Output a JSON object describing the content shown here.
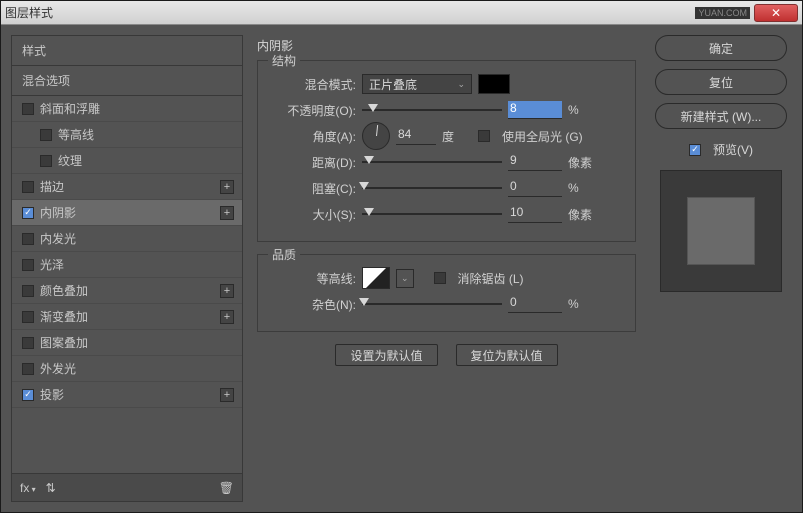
{
  "window": {
    "title": "图层样式"
  },
  "sidebar": {
    "styles_header": "样式",
    "blend_header": "混合选项",
    "items": [
      {
        "label": "斜面和浮雕",
        "checked": false,
        "sub": false,
        "plus": false
      },
      {
        "label": "等高线",
        "checked": false,
        "sub": true,
        "plus": false
      },
      {
        "label": "纹理",
        "checked": false,
        "sub": true,
        "plus": false
      },
      {
        "label": "描边",
        "checked": false,
        "sub": false,
        "plus": true
      },
      {
        "label": "内阴影",
        "checked": true,
        "sub": false,
        "plus": true,
        "selected": true
      },
      {
        "label": "内发光",
        "checked": false,
        "sub": false,
        "plus": false
      },
      {
        "label": "光泽",
        "checked": false,
        "sub": false,
        "plus": false
      },
      {
        "label": "颜色叠加",
        "checked": false,
        "sub": false,
        "plus": true
      },
      {
        "label": "渐变叠加",
        "checked": false,
        "sub": false,
        "plus": true
      },
      {
        "label": "图案叠加",
        "checked": false,
        "sub": false,
        "plus": false
      },
      {
        "label": "外发光",
        "checked": false,
        "sub": false,
        "plus": false
      },
      {
        "label": "投影",
        "checked": true,
        "sub": false,
        "plus": true
      }
    ],
    "fx_label": "fx"
  },
  "main": {
    "panel_title": "内阴影",
    "structure": {
      "title": "结构",
      "blend_mode_label": "混合模式:",
      "blend_mode_value": "正片叠底",
      "opacity_label": "不透明度(O):",
      "opacity_value": "8",
      "opacity_unit": "%",
      "angle_label": "角度(A):",
      "angle_value": "84",
      "angle_unit": "度",
      "global_light_label": "使用全局光 (G)",
      "distance_label": "距离(D):",
      "distance_value": "9",
      "distance_unit": "像素",
      "choke_label": "阻塞(C):",
      "choke_value": "0",
      "choke_unit": "%",
      "size_label": "大小(S):",
      "size_value": "10",
      "size_unit": "像素"
    },
    "quality": {
      "title": "品质",
      "contour_label": "等高线:",
      "antialias_label": "消除锯齿 (L)",
      "noise_label": "杂色(N):",
      "noise_value": "0",
      "noise_unit": "%"
    },
    "buttons": {
      "default": "设置为默认值",
      "reset": "复位为默认值"
    }
  },
  "right": {
    "ok": "确定",
    "cancel": "复位",
    "new_style": "新建样式 (W)...",
    "preview_label": "预览(V)"
  }
}
